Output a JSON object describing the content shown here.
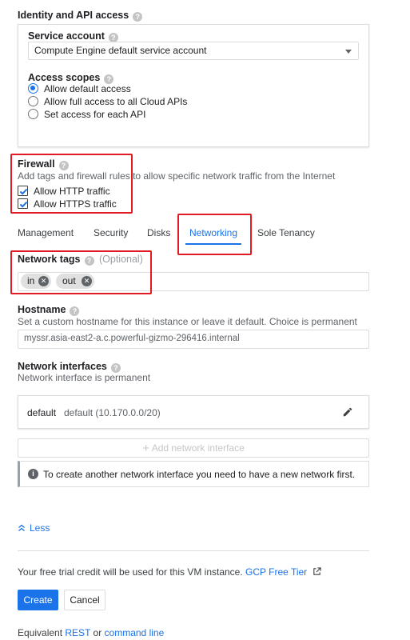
{
  "identity": {
    "title": "Identity and API access",
    "service_account_label": "Service account",
    "service_account_value": "Compute Engine default service account",
    "access_scopes_label": "Access scopes",
    "scopes": [
      {
        "label": "Allow default access",
        "selected": true
      },
      {
        "label": "Allow full access to all Cloud APIs",
        "selected": false
      },
      {
        "label": "Set access for each API",
        "selected": false
      }
    ]
  },
  "firewall": {
    "title": "Firewall",
    "description": "Add tags and firewall rules to allow specific network traffic from the Internet",
    "options": [
      {
        "label": "Allow HTTP traffic",
        "checked": true
      },
      {
        "label": "Allow HTTPS traffic",
        "checked": true
      }
    ]
  },
  "tabs": [
    {
      "label": "Management",
      "active": false
    },
    {
      "label": "Security",
      "active": false
    },
    {
      "label": "Disks",
      "active": false
    },
    {
      "label": "Networking",
      "active": true
    },
    {
      "label": "Sole Tenancy",
      "active": false
    }
  ],
  "network_tags": {
    "label": "Network tags",
    "optional": "(Optional)",
    "tags": [
      "in",
      "out"
    ]
  },
  "hostname": {
    "label": "Hostname",
    "description": "Set a custom hostname for this instance or leave it default. Choice is permanent",
    "value": "myssr.asia-east2-a.c.powerful-gizmo-296416.internal"
  },
  "network_interfaces": {
    "label": "Network interfaces",
    "description": "Network interface is permanent",
    "interface_name": "default",
    "interface_detail": "default (10.170.0.0/20)",
    "add_label": "Add network interface",
    "info": "To create another network interface you need to have a new network first."
  },
  "less_label": "Less",
  "footer": {
    "credit_text": "Your free trial credit will be used for this VM instance.",
    "tier_link": "GCP Free Tier",
    "create_label": "Create",
    "cancel_label": "Cancel",
    "equivalent_text": "Equivalent",
    "rest_link": "REST",
    "or_text": "or",
    "command_line_link": "command line"
  },
  "colors": {
    "accent": "#1a73e8",
    "highlight": "#e01b24"
  }
}
